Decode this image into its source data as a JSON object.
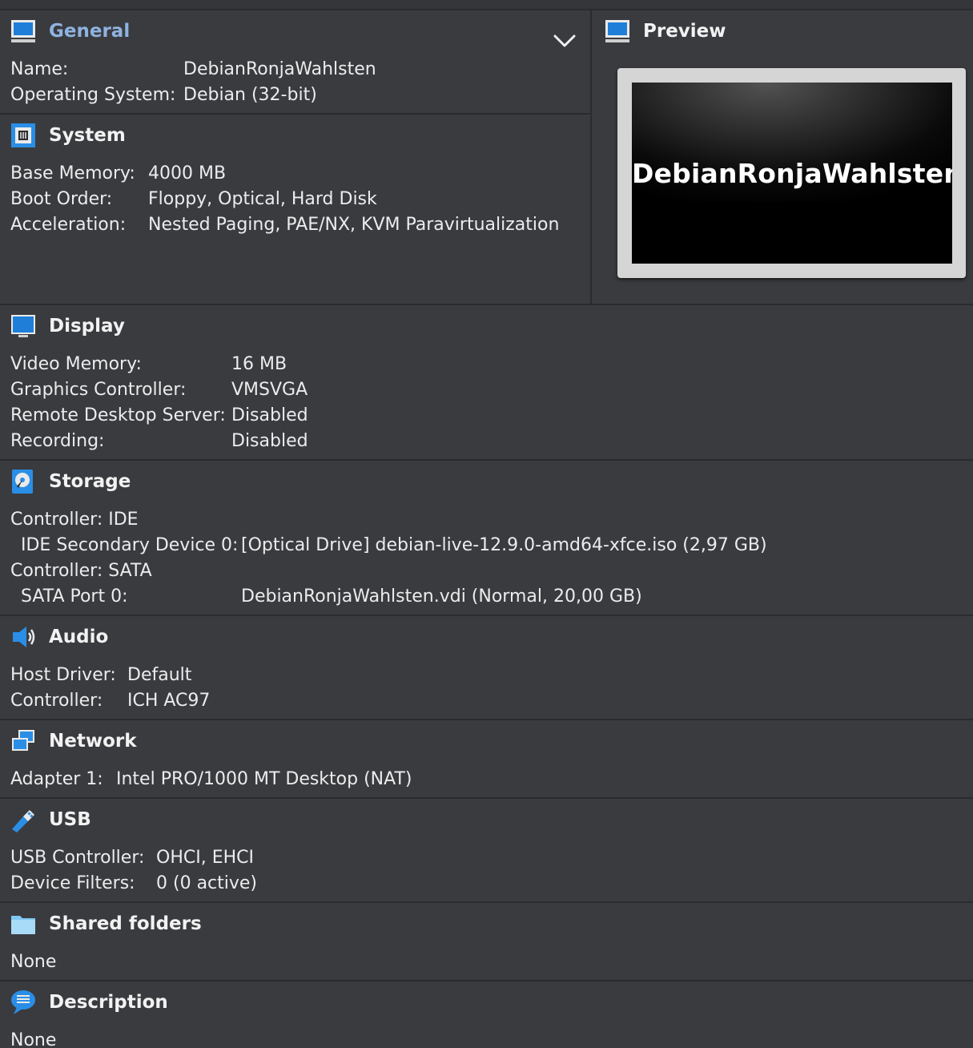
{
  "general": {
    "title": "General",
    "rows": [
      {
        "label": "Name:",
        "value": "DebianRonjaWahlsten"
      },
      {
        "label": "Operating System:",
        "value": "Debian (32-bit)"
      }
    ]
  },
  "preview": {
    "title": "Preview",
    "vm_name": "DebianRonjaWahlsten"
  },
  "system": {
    "title": "System",
    "rows": [
      {
        "label": "Base Memory:",
        "value": "4000 MB"
      },
      {
        "label": "Boot Order:",
        "value": "Floppy, Optical, Hard Disk"
      },
      {
        "label": "Acceleration:",
        "value": "Nested Paging, PAE/NX, KVM Paravirtualization"
      }
    ]
  },
  "display": {
    "title": "Display",
    "rows": [
      {
        "label": "Video Memory:",
        "value": "16 MB"
      },
      {
        "label": "Graphics Controller:",
        "value": "VMSVGA"
      },
      {
        "label": "Remote Desktop Server:",
        "value": "Disabled"
      },
      {
        "label": "Recording:",
        "value": "Disabled"
      }
    ]
  },
  "storage": {
    "title": "Storage",
    "rows": [
      {
        "label": "Controller: IDE",
        "value": ""
      },
      {
        "label": "IDE Secondary Device 0:",
        "value": "[Optical Drive] debian-live-12.9.0-amd64-xfce.iso (2,97 GB)"
      },
      {
        "label": "Controller: SATA",
        "value": ""
      },
      {
        "label": "SATA Port 0:",
        "value": "DebianRonjaWahlsten.vdi (Normal, 20,00 GB)"
      }
    ]
  },
  "audio": {
    "title": "Audio",
    "rows": [
      {
        "label": "Host Driver:",
        "value": "Default"
      },
      {
        "label": "Controller:",
        "value": "ICH AC97"
      }
    ]
  },
  "network": {
    "title": "Network",
    "rows": [
      {
        "label": "Adapter 1:",
        "value": "Intel PRO/1000 MT Desktop (NAT)"
      }
    ]
  },
  "usb": {
    "title": "USB",
    "rows": [
      {
        "label": "USB Controller:",
        "value": "OHCI, EHCI"
      },
      {
        "label": "Device Filters:",
        "value": "0 (0 active)"
      }
    ]
  },
  "shared_folders": {
    "title": "Shared folders",
    "value": "None"
  },
  "description": {
    "title": "Description",
    "value": "None"
  },
  "icons": {
    "general": "monitor-icon",
    "preview": "monitor-icon",
    "system": "chip-icon",
    "display": "display-icon",
    "storage": "hard-disk-icon",
    "audio": "speaker-icon",
    "network": "network-icon",
    "usb": "usb-icon",
    "shared_folders": "folder-icon",
    "description": "speech-bubble-icon",
    "collapse": "chevron-down-icon"
  },
  "colors": {
    "background": "#3a3b3f",
    "separator": "#2a2b2e",
    "text": "#ececec",
    "accent_title": "#8fb3e0",
    "icon_blue": "#2a8ee6"
  }
}
